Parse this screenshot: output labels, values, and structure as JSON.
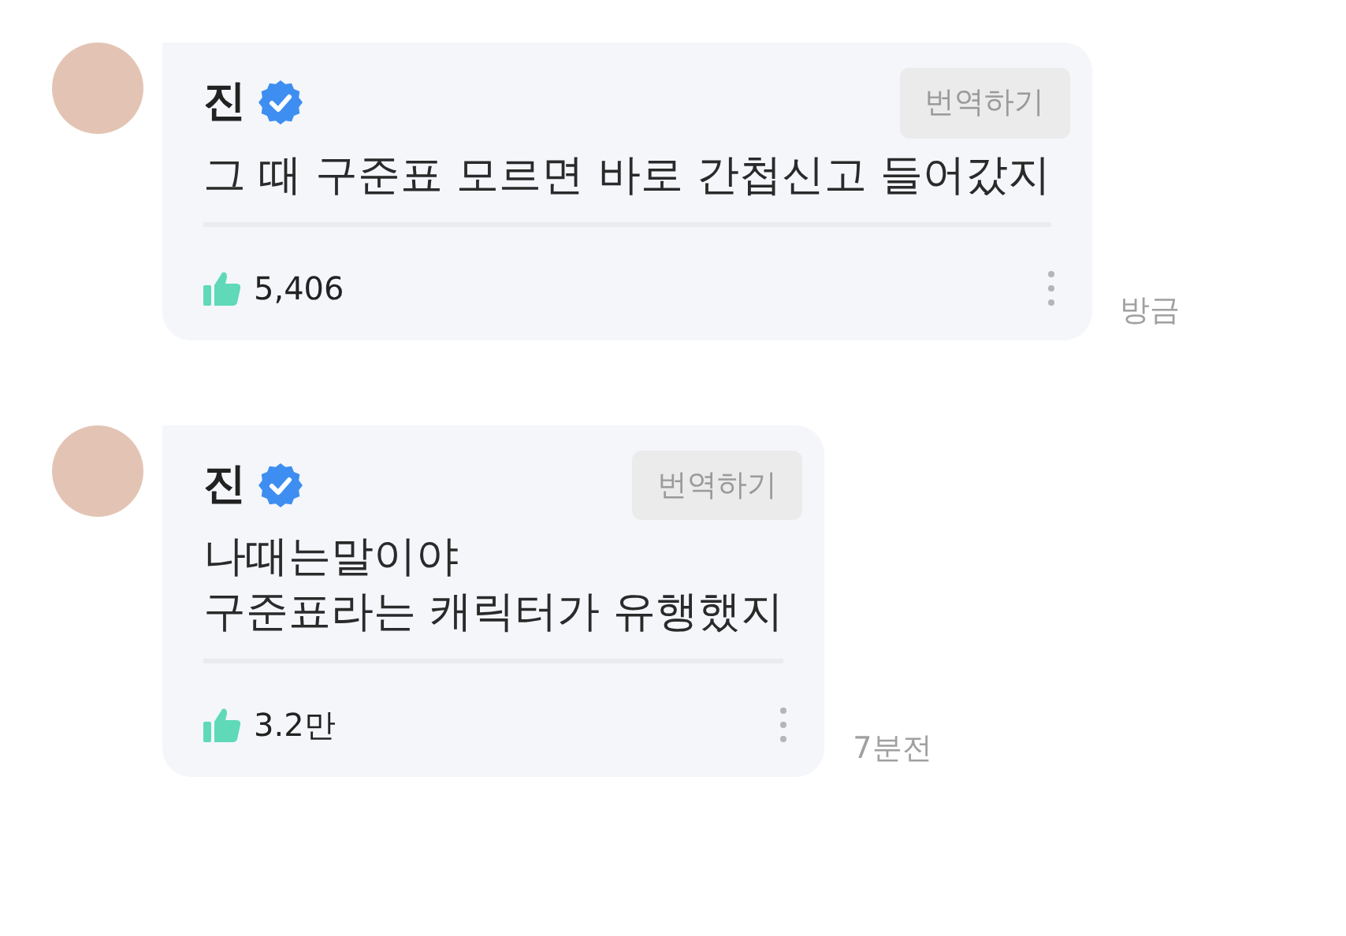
{
  "comments": [
    {
      "author": "진",
      "verified": true,
      "translate_button": "번역하기",
      "message": "그 때 구준표 모르면 바로 간첩신고 들어갔지",
      "likes": "5,406",
      "time": "방금"
    },
    {
      "author": "진",
      "verified": true,
      "translate_button": "번역하기",
      "message": "나때는말이야\n구준표라는 캐릭터가 유행했지",
      "likes": "3.2만",
      "time": "7분전"
    }
  ]
}
